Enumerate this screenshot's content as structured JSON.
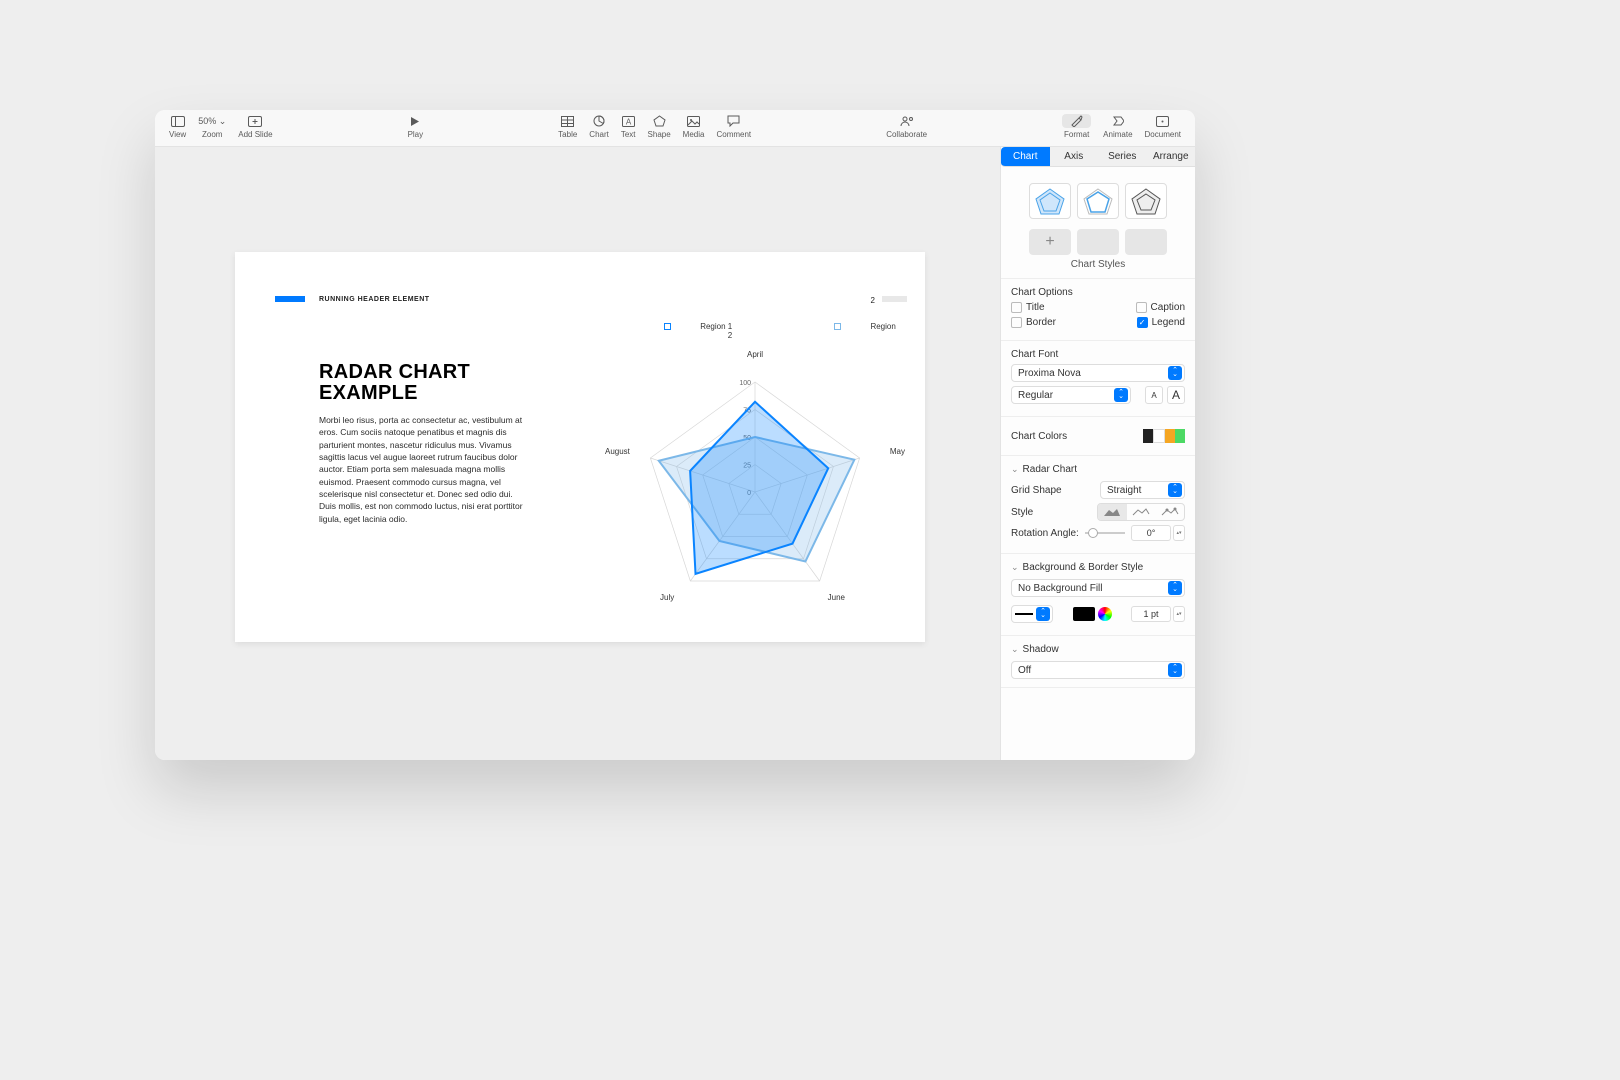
{
  "toolbar": {
    "left": [
      {
        "label": "View",
        "icon": "sidebar-icon"
      },
      {
        "label": "Zoom",
        "icon": "zoom-icon",
        "value": "50% ⌄"
      },
      {
        "label": "Add Slide",
        "icon": "plus-slide-icon"
      }
    ],
    "center_left": {
      "label": "Play",
      "icon": "play-icon"
    },
    "center": [
      {
        "label": "Table",
        "icon": "table-icon"
      },
      {
        "label": "Chart",
        "icon": "chart-icon"
      },
      {
        "label": "Text",
        "icon": "text-icon"
      },
      {
        "label": "Shape",
        "icon": "shape-icon"
      },
      {
        "label": "Media",
        "icon": "media-icon"
      },
      {
        "label": "Comment",
        "icon": "comment-icon"
      }
    ],
    "collab": {
      "label": "Collaborate",
      "icon": "collaborate-icon"
    },
    "right": [
      {
        "label": "Format",
        "icon": "format-icon",
        "selected": true
      },
      {
        "label": "Animate",
        "icon": "animate-icon"
      },
      {
        "label": "Document",
        "icon": "document-icon"
      }
    ]
  },
  "slide": {
    "running_header": "RUNNING HEADER ELEMENT",
    "page_number": "2",
    "title_line1": "RADAR CHART",
    "title_line2": "EXAMPLE",
    "body": "Morbi leo risus, porta ac consectetur ac, vestibulum at eros. Cum sociis natoque penatibus et magnis dis parturient montes, nascetur ridiculus mus. Vivamus sagittis lacus vel augue laoreet rutrum faucibus dolor auctor. Etiam porta sem malesuada magna mollis euismod. Praesent commodo cursus magna, vel scelerisque nisl consectetur et. Donec sed odio dui. Duis mollis, est non commodo luctus, nisi erat porttitor ligula, eget lacinia odio.",
    "legend": {
      "r1": "Region 1",
      "r2": "Region 2"
    },
    "axis_labels": {
      "top": "April",
      "right": "May",
      "br": "June",
      "bl": "July",
      "left": "August"
    },
    "grid_labels": [
      "0",
      "25",
      "50",
      "75",
      "100"
    ]
  },
  "chart_data": {
    "type": "radar",
    "categories": [
      "April",
      "May",
      "June",
      "July",
      "August"
    ],
    "radial_ticks": [
      0,
      25,
      50,
      75,
      100
    ],
    "series": [
      {
        "name": "Region 1",
        "color": "#0a84ff",
        "values": [
          82,
          70,
          58,
          92,
          62
        ]
      },
      {
        "name": "Region 2",
        "color": "#7cb8e8",
        "values": [
          50,
          95,
          78,
          55,
          92
        ]
      }
    ],
    "legend_position": "top"
  },
  "inspector": {
    "tabs": [
      "Chart",
      "Axis",
      "Series",
      "Arrange"
    ],
    "active_tab": "Chart",
    "styles_label": "Chart Styles",
    "options": {
      "header": "Chart Options",
      "title": {
        "label": "Title",
        "checked": false
      },
      "caption": {
        "label": "Caption",
        "checked": false
      },
      "border": {
        "label": "Border",
        "checked": false
      },
      "legend": {
        "label": "Legend",
        "checked": true
      }
    },
    "font": {
      "header": "Chart Font",
      "family": "Proxima Nova",
      "weight": "Regular"
    },
    "colors": {
      "header": "Chart Colors"
    },
    "radar": {
      "header": "Radar Chart",
      "grid_shape_label": "Grid Shape",
      "grid_shape_value": "Straight",
      "style_label": "Style",
      "rotation_label": "Rotation Angle:",
      "rotation_value": "0°"
    },
    "bg": {
      "header": "Background & Border Style",
      "fill": "No Background Fill",
      "stroke_width": "1 pt"
    },
    "shadow": {
      "header": "Shadow",
      "value": "Off"
    }
  }
}
